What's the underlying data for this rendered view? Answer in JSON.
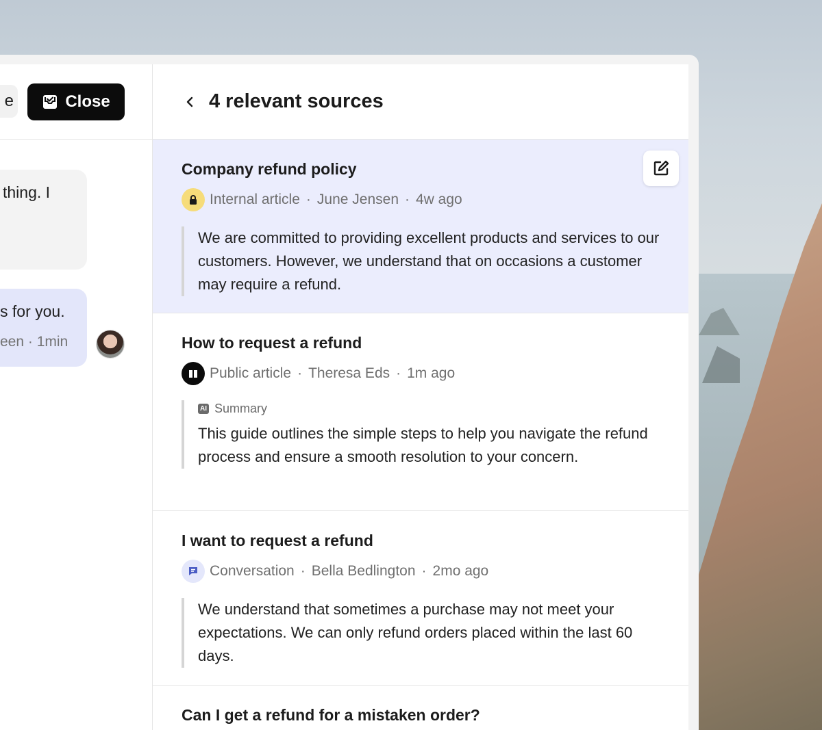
{
  "left_panel": {
    "partial_button_label": "e",
    "close_button_label": "Close",
    "messages": [
      {
        "text": "thing. I"
      },
      {
        "text": "s for you.",
        "meta": "een · 1min"
      }
    ]
  },
  "right_panel": {
    "title": "4 relevant sources",
    "sources": [
      {
        "title": "Company refund policy",
        "type": "Internal article",
        "author": "June Jensen",
        "age": "4w ago",
        "icon": "lock-icon",
        "excerpt": "We are committed to providing excellent products and services to our customers. However, we understand that on occasions a customer may require a refund."
      },
      {
        "title": "How to request a refund",
        "type": "Public article",
        "author": "Theresa Eds",
        "age": "1m ago",
        "icon": "book-icon",
        "ai_chip": "AI",
        "summary_label": "Summary",
        "excerpt": "This guide outlines the simple steps to help you navigate the refund process and ensure a smooth resolution to your concern."
      },
      {
        "title": "I want to request a refund",
        "type": "Conversation",
        "author": "Bella Bedlington",
        "age": "2mo ago",
        "icon": "chat-icon",
        "excerpt": "We understand that sometimes a purchase may not meet your expectations. We can only refund orders placed within the last 60 days."
      },
      {
        "title": "Can I get a refund for a mistaken order?"
      }
    ],
    "separator": "·"
  },
  "colors": {
    "active_source_bg": "#ebedfd",
    "close_button_bg": "#0c0c0c",
    "lock_badge": "#f6dc7a",
    "chat_badge": "#e4e7fb"
  }
}
